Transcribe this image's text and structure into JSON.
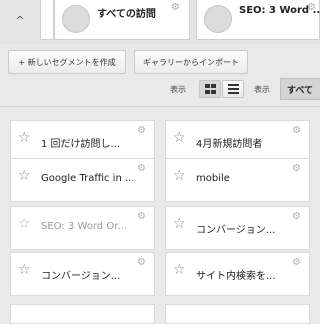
{
  "top": {
    "collapse_glyph": "^",
    "cards": [
      {
        "name": ""
      },
      {
        "name": "すべての訪問"
      },
      {
        "name": "SEO: 3 Word ..."
      }
    ]
  },
  "toolbar": {
    "new_segment_label": "+ 新しいセグメントを作成",
    "import_label": "ギャラリーからインポート",
    "view_label": "表示",
    "filter_label": "表示",
    "filter_value": "すべて"
  },
  "segments": [
    {
      "name": "1 回だけ訪問し..."
    },
    {
      "name": "4月新規訪問者"
    },
    {
      "name": "Google Traffic in ..."
    },
    {
      "name": "mobile"
    },
    {
      "name": "SEO: 3 Word Or..."
    },
    {
      "name": "コンバージョン..."
    },
    {
      "name": "コンバージョン..."
    },
    {
      "name": "サイト内検索を..."
    }
  ]
}
